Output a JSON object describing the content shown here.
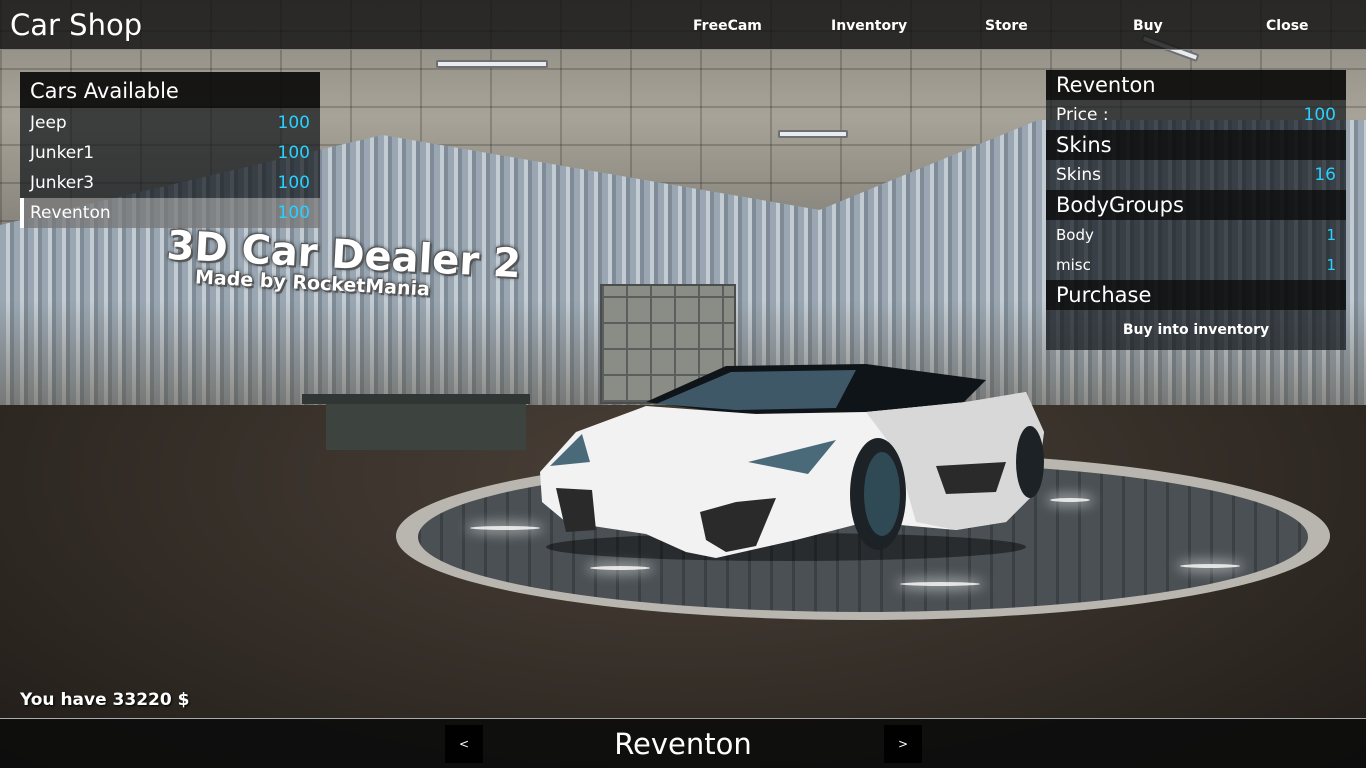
{
  "topbar": {
    "title": "Car Shop",
    "nav": {
      "freecam": "FreeCam",
      "inventory": "Inventory",
      "store": "Store",
      "buy": "Buy",
      "close": "Close"
    }
  },
  "watermark": {
    "title": "3D Car Dealer 2",
    "subtitle": "Made by RocketMania"
  },
  "cars_available": {
    "header": "Cars Available",
    "items": [
      {
        "name": "Jeep",
        "price": "100"
      },
      {
        "name": "Junker1",
        "price": "100"
      },
      {
        "name": "Junker3",
        "price": "100"
      },
      {
        "name": "Reventon",
        "price": "100",
        "selected": true
      }
    ]
  },
  "details": {
    "car_name": "Reventon",
    "price_label": "Price :",
    "price_value": "100",
    "skins_header": "Skins",
    "skins_label": "Skins",
    "skins_value": "16",
    "bodygroups_header": "BodyGroups",
    "bodygroups": [
      {
        "label": "Body",
        "value": "1"
      },
      {
        "label": "misc",
        "value": "1"
      }
    ],
    "purchase_header": "Purchase",
    "buy_button": "Buy into inventory"
  },
  "money": "You have 33220 $",
  "bottombar": {
    "prev": "<",
    "next": ">",
    "current": "Reventon"
  },
  "colors": {
    "accent_value": "#27d2ff",
    "panel_header": "#0a0a0a",
    "panel_row": "#14181c",
    "selected_row": "#787878"
  }
}
